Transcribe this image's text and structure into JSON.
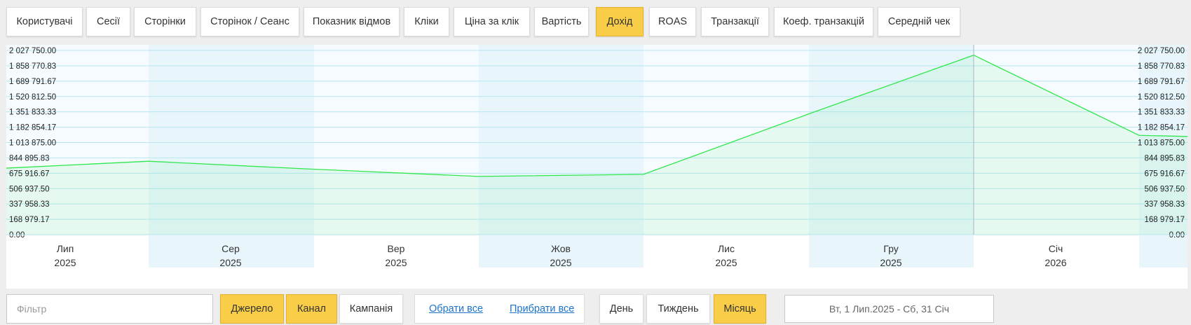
{
  "metric_tabs": [
    {
      "label": "Користувачі",
      "active": false
    },
    {
      "label": "Сесії",
      "active": false
    },
    {
      "label": "Сторінки",
      "active": false
    },
    {
      "label": "Сторінок / Сеанс",
      "active": false
    },
    {
      "label": "Показник відмов",
      "active": false
    },
    {
      "label": "Кліки",
      "active": false
    },
    {
      "label": "Ціна за клік",
      "active": false
    },
    {
      "label": "Вартість",
      "active": false
    },
    {
      "label": "Дохід",
      "active": true
    },
    {
      "label": "ROAS",
      "active": false
    },
    {
      "label": "Транзакції",
      "active": false
    },
    {
      "label": "Коеф. транзакцій",
      "active": false
    },
    {
      "label": "Середній чек",
      "active": false
    }
  ],
  "colors": {
    "accent": "#f9cd48",
    "line": "#2ee84c",
    "fill": "#e9f9ee",
    "band_light": "#f5fbfe",
    "band_dark": "#e8f6fc",
    "grid": "#b9e6f2",
    "link": "#1a73c9"
  },
  "chart_data": {
    "type": "area",
    "y_ticks": [
      "2 027 750.00",
      "1 858 770.83",
      "1 689 791.67",
      "1 520 812.50",
      "1 351 833.33",
      "1 182 854.17",
      "1 013 875.00",
      "844 895.83",
      "675 916.67",
      "506 937.50",
      "337 958.33",
      "168 979.17",
      "0.00"
    ],
    "ylim": [
      0,
      2027750
    ],
    "categories": [
      {
        "month": "Лип",
        "year": "2025"
      },
      {
        "month": "Сер",
        "year": "2025"
      },
      {
        "month": "Вер",
        "year": "2025"
      },
      {
        "month": "Жов",
        "year": "2025"
      },
      {
        "month": "Лис",
        "year": "2025"
      },
      {
        "month": "Гру",
        "year": "2025"
      },
      {
        "month": "Січ",
        "year": "2026"
      }
    ],
    "series": [
      {
        "values": [
          808000,
          641000,
          664000,
          1330000,
          1976000,
          1093000
        ]
      }
    ],
    "grid": true,
    "highlight_category": "Гру"
  },
  "bottom_bar": {
    "filter_placeholder": "Фільтр",
    "group_buttons": [
      {
        "label": "Джерело",
        "active": true
      },
      {
        "label": "Канал",
        "active": true
      },
      {
        "label": "Кампанія",
        "active": false
      }
    ],
    "select_all": "Обрати все",
    "deselect_all": "Прибрати все",
    "period_buttons": [
      {
        "label": "День",
        "active": false
      },
      {
        "label": "Тиждень",
        "active": false
      },
      {
        "label": "Місяць",
        "active": true
      }
    ],
    "date_range": "Вт, 1 Лип.2025 - Сб, 31 Січ"
  }
}
